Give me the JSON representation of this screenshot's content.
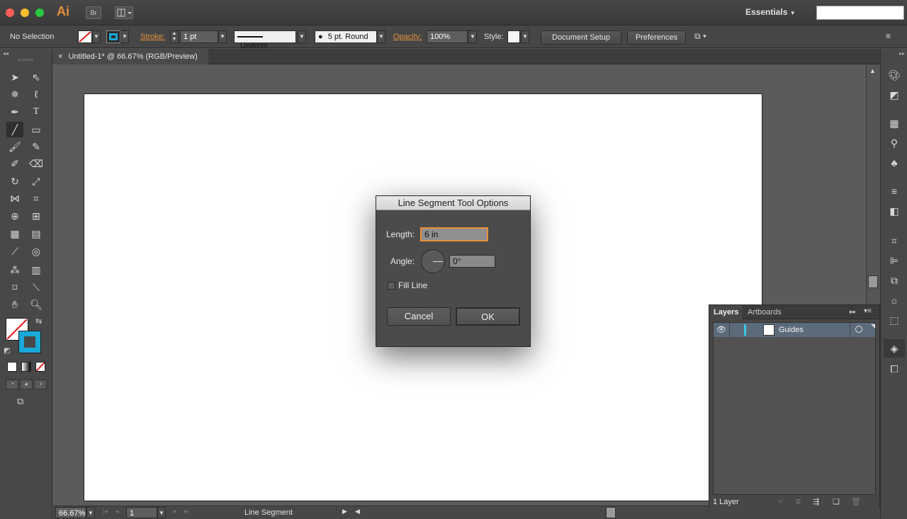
{
  "app": {
    "logo": "Ai",
    "bridge_label": "Br",
    "workspace": "Essentials",
    "search_placeholder": ""
  },
  "control_bar": {
    "selection": "No Selection",
    "stroke_label": "Stroke:",
    "stroke_weight": "1 pt",
    "variable_width": "Uniform",
    "brush": "5 pt. Round",
    "opacity_label": "Opacity:",
    "opacity_value": "100%",
    "style_label": "Style:",
    "document_setup": "Document Setup",
    "preferences": "Preferences"
  },
  "document": {
    "tab_title": "Untitled-1* @ 66.67% (RGB/Preview)"
  },
  "dialog": {
    "title": "Line Segment Tool Options",
    "length_label": "Length:",
    "length_value": "6 in",
    "angle_label": "Angle:",
    "angle_value": "0°",
    "fill_line_label": "Fill Line",
    "cancel": "Cancel",
    "ok": "OK"
  },
  "layers_panel": {
    "tab_layers": "Layers",
    "tab_artboards": "Artboards",
    "layer_name": "Guides",
    "count": "1 Layer"
  },
  "status_bar": {
    "zoom": "66.67%",
    "artboard_number": "1",
    "current_tool": "Line Segment"
  },
  "colors": {
    "accent": "#e8913a",
    "stroke_swatch": "#1aa8d8",
    "layer_color": "#37c8e8"
  }
}
